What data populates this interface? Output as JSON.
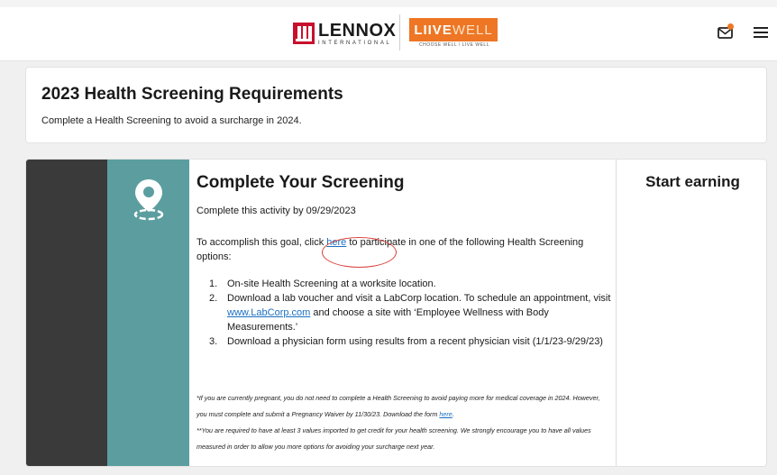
{
  "header": {
    "brand_name": "LENNOX",
    "brand_sub": "INTERNATIONAL",
    "program_logo_live": "LIIVE",
    "program_logo_well": "WELL",
    "program_tagline": "CHOOSE WELL \\ LIVE WELL",
    "icons": [
      "mail-icon",
      "menu-icon"
    ],
    "colors": {
      "brand_red": "#c8102e",
      "brand_orange": "#ee7624"
    }
  },
  "requirements": {
    "title": "2023 Health Screening Requirements",
    "subtitle": "Complete a Health Screening to avoid a surcharge in 2024."
  },
  "activity": {
    "icon": "location-pin-icon",
    "title": "Complete Your Screening",
    "due": "Complete this activity by 09/29/2023",
    "intro_before": "To accomplish this goal, click ",
    "intro_link": "here",
    "intro_after": " to participate in one of the following Health Screening options:",
    "options": [
      {
        "num": "1.",
        "text": "On-site Health Screening at a worksite location."
      },
      {
        "num": "2.",
        "text_before": "Download a lab voucher and visit a LabCorp location.  To schedule an appointment, visit ",
        "link": "www.LabCorp.com",
        "text_after": " and choose a site with ‘Employee Wellness with Body Measurements.’"
      },
      {
        "num": "3.",
        "text": "Download a physician form using results from a recent physician visit (1/1/23-9/29/23)"
      }
    ],
    "fine_print_1_before": "*If you are currently pregnant, you do not need to complete a Health Screening to avoid paying more for medical coverage in 2024. However, you must complete and submit a Pregnancy Waiver by 11/30/23.  Download the form ",
    "fine_print_1_link": "here",
    "fine_print_1_after": ".",
    "fine_print_2": "**You are required to have at least 3 values imported to get credit for your health screening.  We strongly encourage you to have all values measured in order to allow you more options for avoiding your surcharge next year.",
    "side_title": "Start earning",
    "colors": {
      "dark_band": "#3a3a3a",
      "teal_band": "#5c9ea0",
      "link": "#1a6fc2",
      "annotation_circle": "#d9413a"
    }
  }
}
